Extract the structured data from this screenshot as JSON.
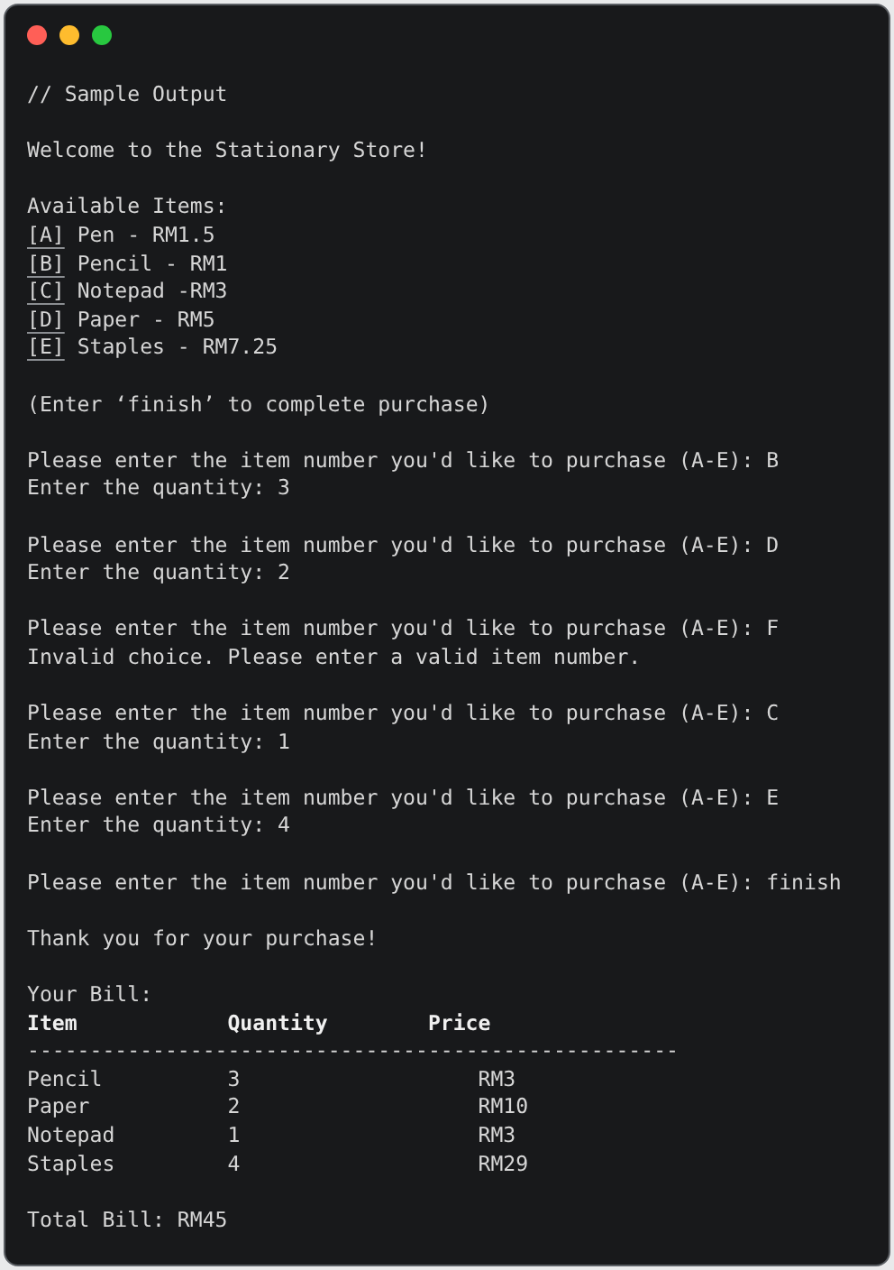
{
  "window": {
    "controls": [
      {
        "color": "#ff5f57"
      },
      {
        "color": "#febc2e"
      },
      {
        "color": "#28c840"
      }
    ]
  },
  "lines": [
    {
      "kind": "comment",
      "text": "// Sample Output"
    },
    {
      "kind": "blank"
    },
    {
      "kind": "text",
      "text": "Welcome to the Stationary Store!"
    },
    {
      "kind": "blank"
    },
    {
      "kind": "text",
      "text": "Available Items:"
    },
    {
      "kind": "item",
      "key": "[A]",
      "text": "Pen - RM1.5"
    },
    {
      "kind": "item",
      "key": "[B]",
      "text": "Pencil - RM1"
    },
    {
      "kind": "item",
      "key": "[C]",
      "text": "Notepad -RM3"
    },
    {
      "kind": "item",
      "key": "[D]",
      "text": "Paper - RM5"
    },
    {
      "kind": "item",
      "key": "[E]",
      "text": "Staples - RM7.25"
    },
    {
      "kind": "blank"
    },
    {
      "kind": "text",
      "text": "(Enter ‘finish’ to complete purchase)"
    },
    {
      "kind": "blank"
    },
    {
      "kind": "text",
      "text": "Please enter the item number you'd like to purchase (A-E): B"
    },
    {
      "kind": "text",
      "text": "Enter the quantity: 3"
    },
    {
      "kind": "blank"
    },
    {
      "kind": "text",
      "text": "Please enter the item number you'd like to purchase (A-E): D"
    },
    {
      "kind": "text",
      "text": "Enter the quantity: 2"
    },
    {
      "kind": "blank"
    },
    {
      "kind": "text",
      "text": "Please enter the item number you'd like to purchase (A-E): F"
    },
    {
      "kind": "text",
      "text": "Invalid choice. Please enter a valid item number."
    },
    {
      "kind": "blank"
    },
    {
      "kind": "text",
      "text": "Please enter the item number you'd like to purchase (A-E): C"
    },
    {
      "kind": "text",
      "text": "Enter the quantity: 1"
    },
    {
      "kind": "blank"
    },
    {
      "kind": "text",
      "text": "Please enter the item number you'd like to purchase (A-E): E"
    },
    {
      "kind": "text",
      "text": "Enter the quantity: 4"
    },
    {
      "kind": "blank"
    },
    {
      "kind": "text",
      "text": "Please enter the item number you'd like to purchase (A-E): finish"
    },
    {
      "kind": "blank"
    },
    {
      "kind": "text",
      "text": "Thank you for your purchase!"
    },
    {
      "kind": "blank"
    },
    {
      "kind": "text",
      "text": "Your Bill:"
    }
  ],
  "bill": {
    "columns": [
      "Item",
      "Quantity",
      "Price"
    ],
    "rule": "----------------------------------------------------",
    "rows": [
      [
        "Pencil",
        "3",
        "RM3"
      ],
      [
        "Paper",
        "2",
        "RM10"
      ],
      [
        "Notepad",
        "1",
        "RM3"
      ],
      [
        "Staples",
        "4",
        "RM29"
      ]
    ]
  },
  "total": "Total Bill: RM45"
}
